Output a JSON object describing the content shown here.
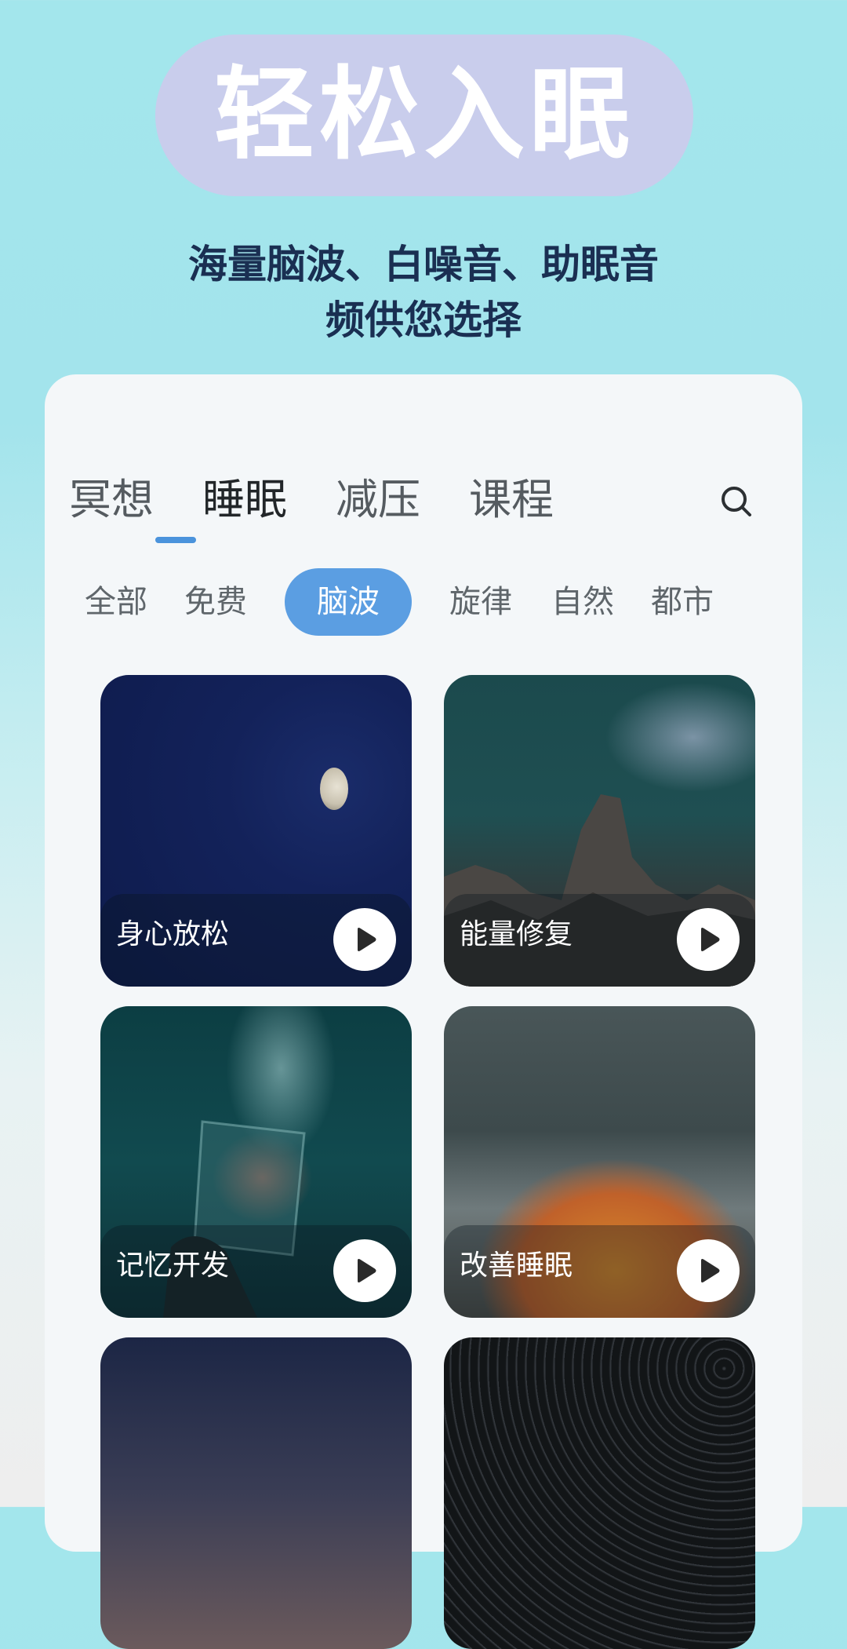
{
  "hero": {
    "title": "轻松入眠",
    "subtitle_line1": "海量脑波、白噪音、助眠音",
    "subtitle_line2": "频供您选择"
  },
  "tabs": [
    {
      "label": "冥想",
      "active": false
    },
    {
      "label": "睡眠",
      "active": true
    },
    {
      "label": "减压",
      "active": false
    },
    {
      "label": "课程",
      "active": false
    }
  ],
  "search": {
    "icon": "search-icon"
  },
  "chips": [
    {
      "label": "全部",
      "active": false
    },
    {
      "label": "免费",
      "active": false
    },
    {
      "label": "脑波",
      "active": true
    },
    {
      "label": "旋律",
      "active": false
    },
    {
      "label": "自然",
      "active": false
    },
    {
      "label": "都市",
      "active": false
    }
  ],
  "cards": [
    {
      "label": "身心放松",
      "play_icon": "play-icon"
    },
    {
      "label": "能量修复",
      "play_icon": "play-icon"
    },
    {
      "label": "记忆开发",
      "play_icon": "play-icon"
    },
    {
      "label": "改善睡眠",
      "play_icon": "play-icon"
    }
  ],
  "colors": {
    "accent": "#5b9ee2",
    "hero_pill": "#c9cdec",
    "hero_subtitle": "#1a2f52"
  }
}
